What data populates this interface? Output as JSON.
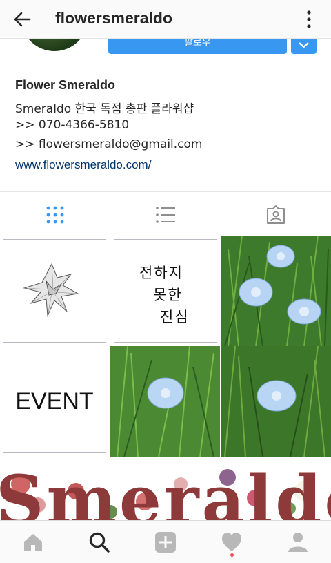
{
  "topbar": {
    "username": "flowersmeraldo",
    "back_icon": "arrow-left-icon",
    "more_icon": "more-vertical-icon"
  },
  "profile": {
    "follow_label": "팔로우"
  },
  "bio": {
    "name": "Flower Smeraldo",
    "line1": "Smeraldo 한국 독점 총판 플라워샵",
    "line2": ">> 070-4366-5810",
    "line3": ">> flowersmeraldo@gmail.com",
    "link": "www.flowersmeraldo.com/"
  },
  "tabs": [
    {
      "icon": "grid-icon",
      "active": true
    },
    {
      "icon": "list-icon",
      "active": false
    },
    {
      "icon": "tagged-icon",
      "active": false
    }
  ],
  "posts": {
    "event_text": "EVENT",
    "calligraphy": [
      "전하지",
      "못한",
      "진심"
    ]
  },
  "banner": {
    "text": "Smeraldo"
  },
  "bottom_nav": [
    "home-icon",
    "search-icon",
    "add-icon",
    "activity-icon",
    "profile-icon"
  ],
  "colors": {
    "accent": "#3897f0",
    "link": "#003569",
    "active_tab": "#3897f0",
    "notification_dot": "#ed4956"
  }
}
